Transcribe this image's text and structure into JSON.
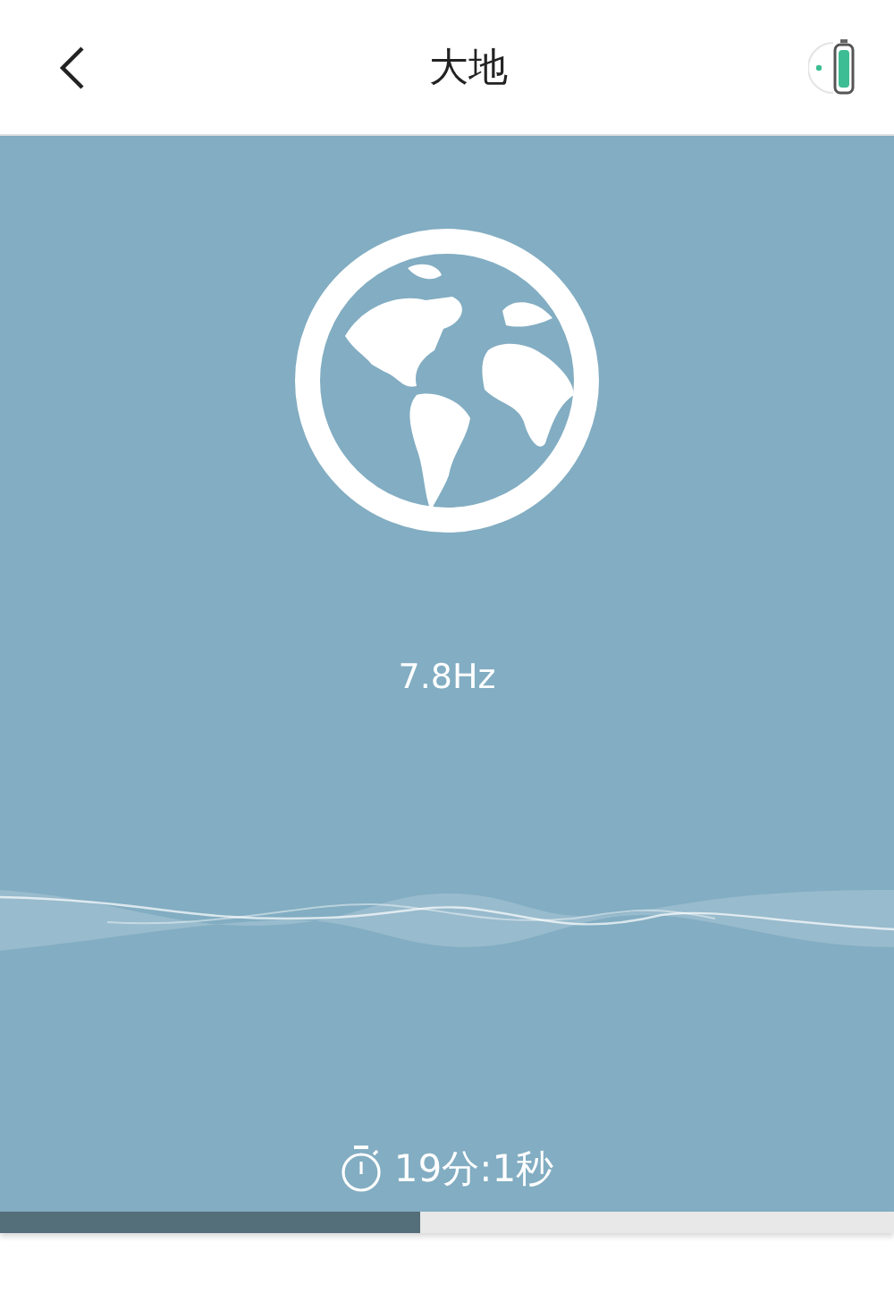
{
  "header": {
    "title": "大地"
  },
  "mode": {
    "frequency": "7.8Hz"
  },
  "timer": {
    "remaining": "19分:1秒"
  },
  "progress": {
    "level": 0.47
  }
}
